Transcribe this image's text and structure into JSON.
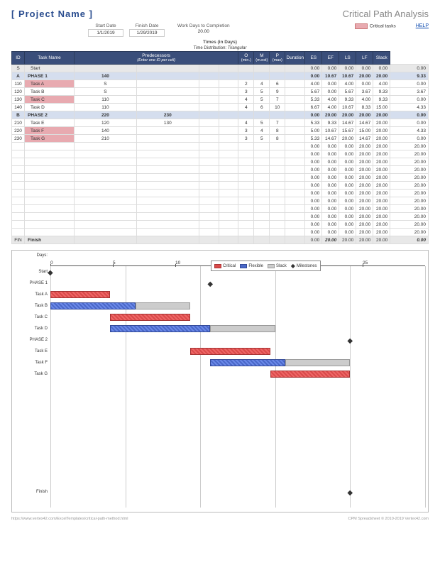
{
  "title": "[ Project Name ]",
  "subtitle": "Critical Path Analysis",
  "meta": {
    "start_label": "Start Date",
    "start": "1/1/2019",
    "finish_label": "Finish Date",
    "finish": "1/29/2019",
    "wd_label": "Work Days to Completion",
    "wd": "20.00",
    "crit_label": "Critical tasks",
    "help": "HELP"
  },
  "times_label": "Times (in Days)",
  "dist_label": "Time Distribution:",
  "dist_val": "Triangular",
  "cols": [
    "ID",
    "Task Name",
    "Predecessors",
    "",
    "",
    "",
    "O\n(min.)",
    "M\n(m.est)",
    "P\n(max)",
    "Duration",
    "ES",
    "EF",
    "LS",
    "LF",
    "Slack"
  ],
  "pred_sub": "(Enter one ID per cell)",
  "rows": [
    {
      "id": "S",
      "nm": "Start",
      "type": "sr",
      "v": [
        "",
        "",
        "",
        "",
        "",
        "",
        "",
        "",
        "0.00",
        "0.00",
        "0.00",
        "0.00",
        "0.00",
        "0.00"
      ]
    },
    {
      "id": "A",
      "nm": "PHASE 1",
      "type": "ph",
      "v": [
        "140",
        "",
        "",
        "",
        "",
        "",
        "",
        "",
        "0.00",
        "10.67",
        "10.67",
        "20.00",
        "20.00",
        "9.33"
      ]
    },
    {
      "id": "110",
      "nm": "Task A",
      "type": "cr",
      "v": [
        "S",
        "",
        "",
        "",
        "2",
        "4",
        "6",
        "",
        "4.00",
        "0.00",
        "4.00",
        "0.00",
        "4.00",
        "0.00"
      ]
    },
    {
      "id": "120",
      "nm": "Task B",
      "type": "",
      "v": [
        "S",
        "",
        "",
        "",
        "3",
        "5",
        "9",
        "",
        "5.67",
        "0.00",
        "5.67",
        "3.67",
        "9.33",
        "3.67"
      ]
    },
    {
      "id": "130",
      "nm": "Task C",
      "type": "cr",
      "v": [
        "110",
        "",
        "",
        "",
        "4",
        "5",
        "7",
        "",
        "5.33",
        "4.00",
        "9.33",
        "4.00",
        "9.33",
        "0.00"
      ]
    },
    {
      "id": "140",
      "nm": "Task D",
      "type": "",
      "v": [
        "110",
        "",
        "",
        "",
        "4",
        "6",
        "10",
        "",
        "6.67",
        "4.00",
        "10.67",
        "8.33",
        "15.00",
        "4.33"
      ]
    },
    {
      "id": "B",
      "nm": "PHASE 2",
      "type": "ph",
      "v": [
        "220",
        "230",
        "",
        "",
        "",
        "",
        "",
        "",
        "0.00",
        "20.00",
        "20.00",
        "20.00",
        "20.00",
        "0.00"
      ]
    },
    {
      "id": "210",
      "nm": "Task E",
      "type": "",
      "v": [
        "120",
        "130",
        "",
        "",
        "4",
        "5",
        "7",
        "",
        "5.33",
        "9.33",
        "14.67",
        "14.67",
        "20.00",
        "0.00"
      ]
    },
    {
      "id": "220",
      "nm": "Task F",
      "type": "cr",
      "v": [
        "140",
        "",
        "",
        "",
        "3",
        "4",
        "8",
        "",
        "5.00",
        "10.67",
        "15.67",
        "15.00",
        "20.00",
        "4.33"
      ]
    },
    {
      "id": "230",
      "nm": "Task G",
      "type": "cr",
      "v": [
        "210",
        "",
        "",
        "",
        "3",
        "5",
        "8",
        "",
        "5.33",
        "14.67",
        "20.00",
        "14.67",
        "20.00",
        "0.00"
      ]
    }
  ],
  "empty_rows": 12,
  "empty_v": [
    "",
    "",
    "",
    "",
    "",
    "",
    "",
    "",
    "0.00",
    "0.00",
    "0.00",
    "20.00",
    "20.00",
    "20.00"
  ],
  "fin": {
    "id": "FIN",
    "nm": "Finish",
    "v": [
      "",
      "",
      "",
      "",
      "",
      "",
      "",
      "",
      "0.00",
      "20.00",
      "20.00",
      "20.00",
      "20.00",
      "0.00"
    ]
  },
  "chart_data": {
    "type": "gantt",
    "xlabel": "Days:",
    "xmax": 25,
    "ticks": [
      0,
      5,
      10,
      15,
      20,
      25
    ],
    "legend": [
      "Critical",
      "Flexible",
      "Slack",
      "Milestones"
    ],
    "tasks": [
      {
        "name": "Start",
        "ms": 0
      },
      {
        "name": "PHASE 1",
        "ms": 10.67
      },
      {
        "name": "Task A",
        "bars": [
          {
            "t": "c",
            "s": 0,
            "e": 4
          }
        ]
      },
      {
        "name": "Task B",
        "bars": [
          {
            "t": "f",
            "s": 0,
            "e": 5.67
          },
          {
            "t": "s",
            "s": 5.67,
            "e": 9.33
          }
        ]
      },
      {
        "name": "Task C",
        "bars": [
          {
            "t": "c",
            "s": 4,
            "e": 9.33
          }
        ]
      },
      {
        "name": "Task D",
        "bars": [
          {
            "t": "f",
            "s": 4,
            "e": 10.67
          },
          {
            "t": "s",
            "s": 10.67,
            "e": 15
          }
        ]
      },
      {
        "name": "PHASE 2",
        "ms": 20
      },
      {
        "name": "Task E",
        "bars": [
          {
            "t": "c",
            "s": 9.33,
            "e": 14.67
          }
        ]
      },
      {
        "name": "Task F",
        "bars": [
          {
            "t": "f",
            "s": 10.67,
            "e": 15.67
          },
          {
            "t": "s",
            "s": 15.67,
            "e": 20
          }
        ]
      },
      {
        "name": "Task G",
        "bars": [
          {
            "t": "c",
            "s": 14.67,
            "e": 20
          }
        ]
      }
    ],
    "finish": {
      "name": "Finish",
      "ms": 20
    }
  },
  "footer": {
    "left": "https://www.vertex42.com/ExcelTemplates/critical-path-method.html",
    "right": "CPM Spreadsheet © 2010-2019 Vertex42.com"
  }
}
